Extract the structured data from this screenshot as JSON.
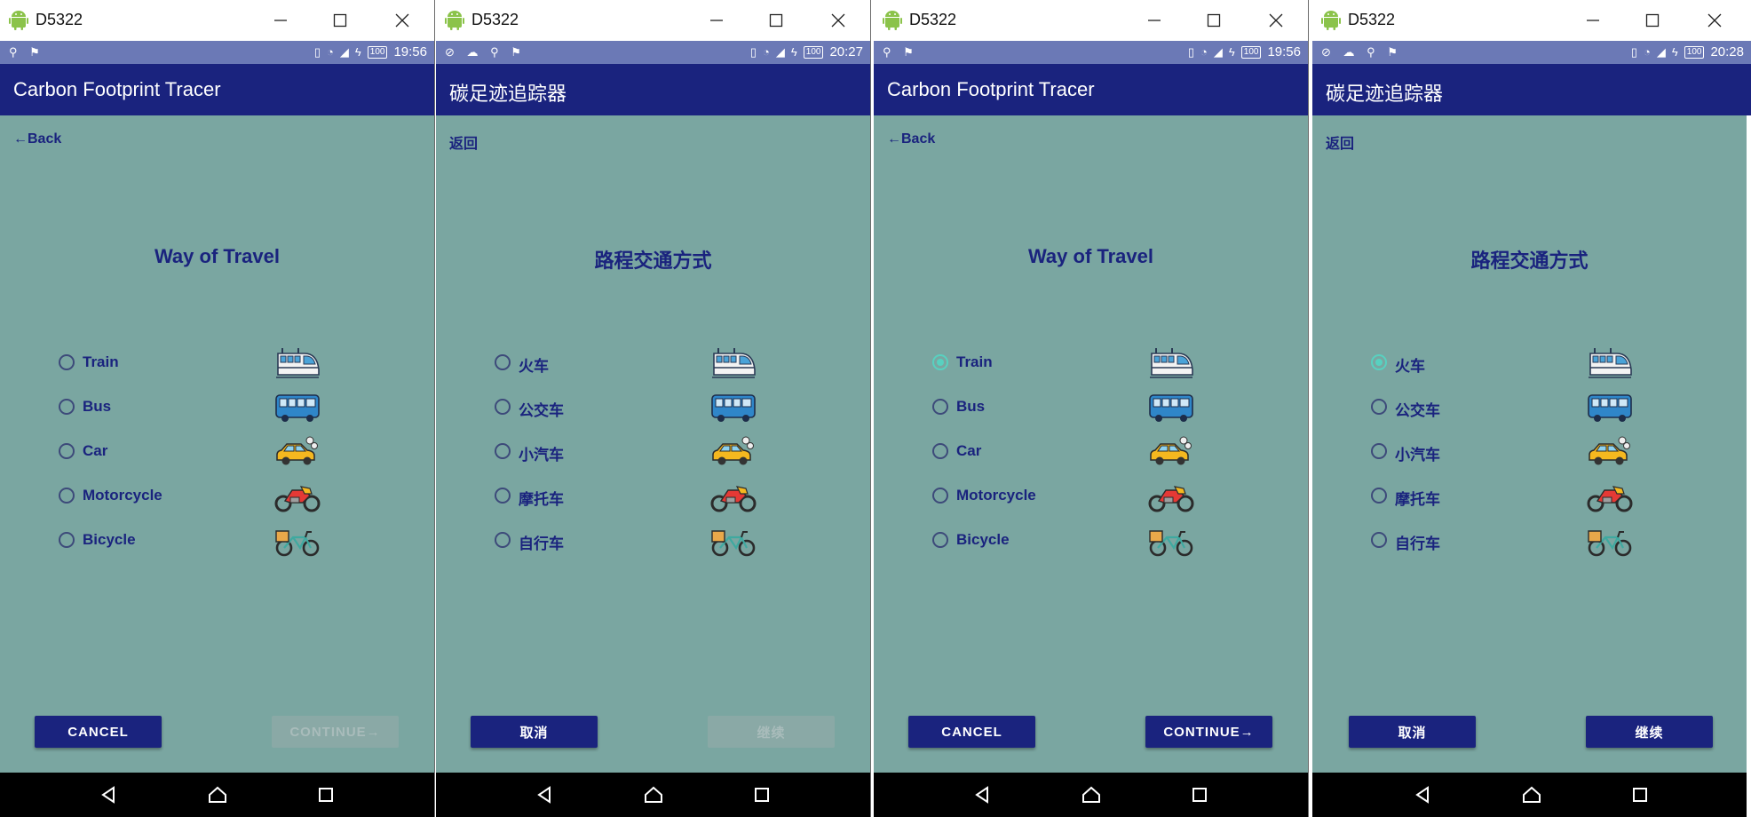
{
  "colors": {
    "statusbar": "#6b79b6",
    "appbar": "#1a237e",
    "content_bg": "#7aa6a1",
    "accent": "#58d1c0",
    "primary_text": "#1a237e",
    "button": "#1a237e",
    "button_disabled": "#8aa9a6"
  },
  "icons": {
    "train": "high-speed-train-icon",
    "bus": "bus-icon",
    "car": "car-with-exhaust-icon",
    "motorcycle": "motorcycle-icon",
    "bicycle": "bicycle-with-basket-icon"
  },
  "windows": [
    {
      "window_title": "D5322",
      "status_time": "19:56",
      "status_left": "⚲ ⚑",
      "battery": "100",
      "app_title": "Carbon Footprint Tracer",
      "back_label": "←Back",
      "heading": "Way of Travel",
      "options": [
        {
          "label": "Train",
          "checked": false
        },
        {
          "label": "Bus",
          "checked": false
        },
        {
          "label": "Car",
          "checked": false
        },
        {
          "label": "Motorcycle",
          "checked": false
        },
        {
          "label": "Bicycle",
          "checked": false
        }
      ],
      "cancel_label": "CANCEL",
      "continue_label": "CONTINUE→",
      "continue_enabled": false
    },
    {
      "window_title": "D5322",
      "status_time": "20:27",
      "status_left": "⊘ ☁ ⚲ ⚑",
      "battery": "100",
      "app_title": "碳足迹追踪器",
      "back_label": "返回",
      "heading": "路程交通方式",
      "options": [
        {
          "label": "火车",
          "checked": false
        },
        {
          "label": "公交车",
          "checked": false
        },
        {
          "label": "小汽车",
          "checked": false
        },
        {
          "label": "摩托车",
          "checked": false
        },
        {
          "label": "自行车",
          "checked": false
        }
      ],
      "cancel_label": "取消",
      "continue_label": "继续",
      "continue_enabled": false
    },
    {
      "window_title": "D5322",
      "status_time": "19:56",
      "status_left": "⚲ ⚑",
      "battery": "100",
      "app_title": "Carbon Footprint Tracer",
      "back_label": "←Back",
      "heading": "Way of Travel",
      "options": [
        {
          "label": "Train",
          "checked": true
        },
        {
          "label": "Bus",
          "checked": false
        },
        {
          "label": "Car",
          "checked": false
        },
        {
          "label": "Motorcycle",
          "checked": false
        },
        {
          "label": "Bicycle",
          "checked": false
        }
      ],
      "cancel_label": "CANCEL",
      "continue_label": "CONTINUE→",
      "continue_enabled": true
    },
    {
      "window_title": "D5322",
      "status_time": "20:28",
      "status_left": "⊘ ☁ ⚲ ⚑",
      "battery": "100",
      "app_title": "碳足迹追踪器",
      "back_label": "返回",
      "heading": "路程交通方式",
      "options": [
        {
          "label": "火车",
          "checked": true
        },
        {
          "label": "公交车",
          "checked": false
        },
        {
          "label": "小汽车",
          "checked": false
        },
        {
          "label": "摩托车",
          "checked": false
        },
        {
          "label": "自行车",
          "checked": false
        }
      ],
      "cancel_label": "取消",
      "continue_label": "继续",
      "continue_enabled": true
    }
  ]
}
